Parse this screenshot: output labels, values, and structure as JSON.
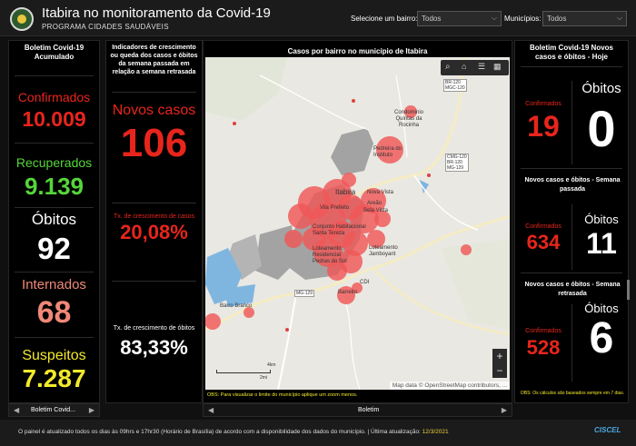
{
  "header": {
    "title": "Itabira no monitoramento da Covid-19",
    "subtitle": "PROGRAMA CIDADES SAUDÁVEIS",
    "bairro_label": "Selecione um bairro:",
    "bairro_value": "Todos",
    "municipios_label": "Municípios:",
    "municipios_value": "Todos"
  },
  "left_panel": {
    "heading": "Boletim Covid-19 Acumulado",
    "confirmados_label": "Confirmados",
    "confirmados_value": "10.009",
    "recuperados_label": "Recuperados",
    "recuperados_value": "9.139",
    "obitos_label": "Óbitos",
    "obitos_value": "92",
    "internados_label": "Internados",
    "internados_value": "68",
    "suspeitos_label": "Suspeitos",
    "suspeitos_value": "7.287",
    "tab_label": "Boletim Covid..."
  },
  "indicators": {
    "heading": "Indicadores de crescimento ou queda dos casos e óbitos da semana passada em relação a semana retrasada",
    "novos_label": "Novos casos",
    "novos_value": "106",
    "tx_casos_label": "Tx. de crescimento de casos",
    "tx_casos_value": "20,08%",
    "tx_obitos_label": "Tx. de crescimento de óbitos",
    "tx_obitos_value": "83,33%"
  },
  "map": {
    "heading": "Casos por bairro no município de Itabira",
    "labels": {
      "condominio": "Condominio Quintas da Rocinha",
      "pedreira": "Pedreira do Instituto",
      "itabira": "Itabira",
      "nova_vista": "Nova Vista",
      "areao": "Areão",
      "bela_vista": "Bela Vista",
      "vila_prefeito": "Vila Prefeito",
      "conjunto": "Conjunto Habitacional Santa Tereza",
      "loteamento_jambo": "Loteamento Jamboyant",
      "loteamento_pedras": "Loteamento Residencial Pedras do Sol",
      "barreiro": "Barreiro",
      "cdi": "CDI",
      "barro_branco": "Barro Branco",
      "br120": "BR-120",
      "mgc120": "MGC-120",
      "cmg": "CMG-120",
      "br120b": "BR-120",
      "mg129": "MG-129",
      "mg129b": "MG-129"
    },
    "scale_km": "4km",
    "scale_mi": "2mi",
    "attribution": "Map data © OpenStreetMap contributors, ...",
    "zoom_in": "+",
    "zoom_out": "−",
    "obs": "OBS: Para visualizar o limite do município aplique um zoom menos.",
    "tab_label": "Boletim"
  },
  "right_panel": {
    "heading": "Boletim Covid-19 Novos casos e óbitos - Hoje",
    "today_confirmados_label": "Confirmados",
    "today_confirmados_value": "19",
    "today_obitos_label": "Óbitos",
    "today_obitos_value": "0",
    "passada_heading": "Novos casos e óbitos - Semana passada",
    "passada_confirmados_label": "Confirmados",
    "passada_confirmados_value": "634",
    "passada_obitos_label": "Óbitos",
    "passada_obitos_value": "11",
    "retrasada_heading": "Novos casos e óbitos - Semana retrasada",
    "retrasada_confirmados_label": "Confirmados",
    "retrasada_confirmados_value": "528",
    "retrasada_obitos_label": "Óbitos",
    "retrasada_obitos_value": "6",
    "obs": "OBS: Os cálculos são baseados sempre em 7 dias."
  },
  "footer": {
    "text": "O painel é atualizado todos os dias às 09hrs e 17hr30 (Horário de Brasília) de acordo com a disponibilidade dos dados do município. | Última atualização:",
    "date": "12/3/2021",
    "brand": "CISCEL"
  },
  "colors": {
    "red": "#e8251c",
    "green": "#55d63a",
    "salmon": "#f08878",
    "yellow": "#f2ea2b"
  }
}
